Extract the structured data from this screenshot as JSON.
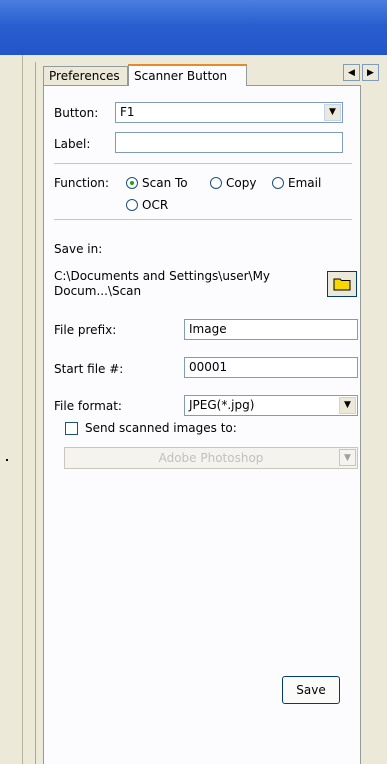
{
  "tabs": {
    "preferences": "Preferences",
    "scanner_button": "Scanner Button"
  },
  "button": {
    "label": "Button:",
    "value": "F1"
  },
  "label_field": {
    "label": "Label:",
    "value": ""
  },
  "function": {
    "label": "Function:",
    "options": {
      "scan_to": "Scan To",
      "copy": "Copy",
      "email": "Email",
      "ocr": "OCR"
    },
    "selected": "scan_to"
  },
  "save_in": {
    "label": "Save in:",
    "path_line1": "C:\\Documents and Settings\\user\\My",
    "path_line2": "Docum...\\Scan"
  },
  "file_prefix": {
    "label": "File prefix:",
    "value": "Image"
  },
  "start_file": {
    "label": "Start file #:",
    "value": "00001"
  },
  "file_format": {
    "label": "File format:",
    "value": "JPEG(*.jpg)"
  },
  "send_to": {
    "label": "Send scanned images to:",
    "checked": false,
    "app": "Adobe Photoshop"
  },
  "save_label": "Save",
  "colors": {
    "titlebar": "#2a5fd0",
    "tab_highlight": "#e68b2c",
    "radio_dot": "#21a121",
    "folder_icon": "#f8d800"
  }
}
